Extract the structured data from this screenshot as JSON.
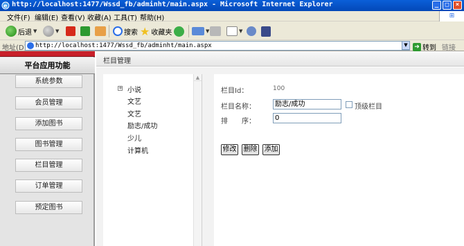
{
  "window": {
    "title": "http://localhost:1477/Wssd_fb/adminht/main.aspx - Microsoft Internet Explorer",
    "buttons": [
      "_",
      "□",
      "×"
    ]
  },
  "menubar": {
    "items": [
      "文件(F)",
      "编辑(E)",
      "查看(V)",
      "收藏(A)",
      "工具(T)",
      "帮助(H)"
    ]
  },
  "toolbar": {
    "back_label": "后退",
    "search_label": "搜索",
    "favorites_label": "收藏夹"
  },
  "addressbar": {
    "label": "地址(D)",
    "url": "http://localhost:1477/Wssd_fb/adminht/main.aspx",
    "go_label": "转到",
    "links_label": "链接"
  },
  "sidebar": {
    "title": "平台应用功能",
    "items": [
      {
        "label": "系统参数"
      },
      {
        "label": "会员管理"
      },
      {
        "label": "添加图书"
      },
      {
        "label": "图书管理"
      },
      {
        "label": "栏目管理"
      },
      {
        "label": "订单管理"
      },
      {
        "label": "预定图书"
      }
    ]
  },
  "main": {
    "header_title": "栏目管理",
    "tree": {
      "expander": "+",
      "items": [
        "小说",
        "文艺",
        "文艺",
        "励志/成功",
        "少儿",
        "计算机"
      ]
    },
    "form": {
      "id_label": "栏目Id：",
      "id_value": "100",
      "name_label": "栏目名称：",
      "name_value": "励志/成功",
      "top_level_label": "顶级栏目",
      "top_level_checked": false,
      "order_label": "排　　序：",
      "order_value": "0",
      "buttons": {
        "modify": "修改",
        "delete": "删除",
        "add": "添加"
      }
    }
  }
}
